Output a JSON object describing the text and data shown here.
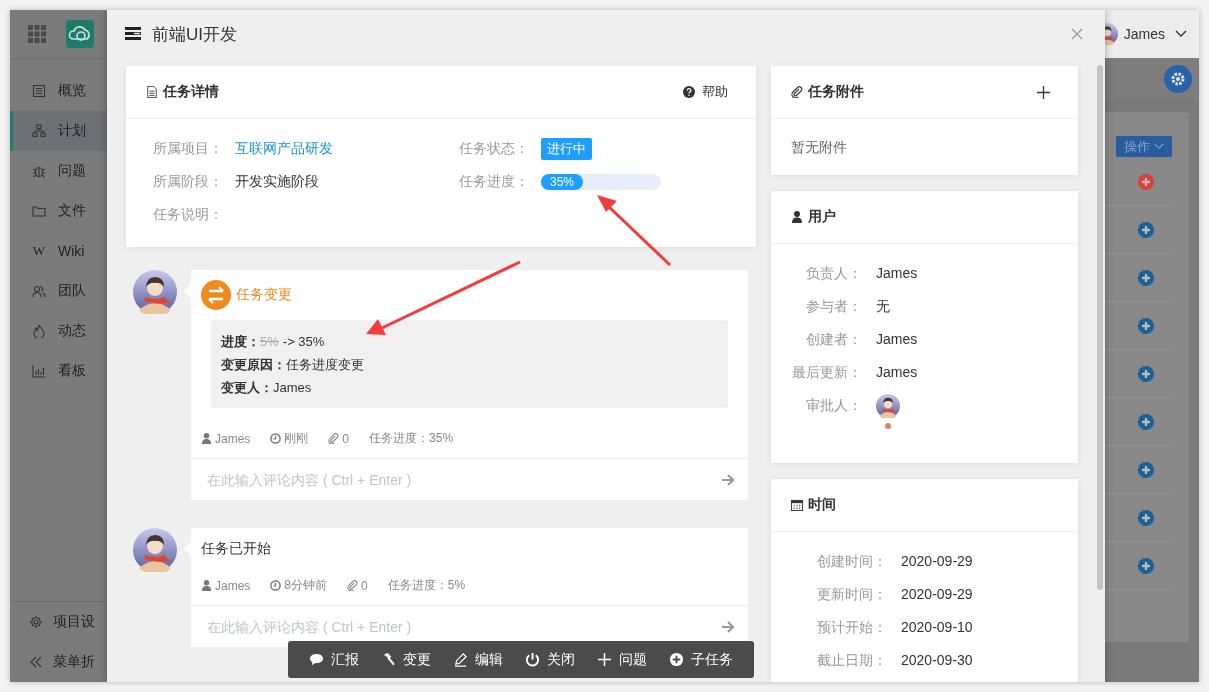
{
  "app": {
    "sidebar": {
      "items": [
        {
          "label": "概览",
          "selected": false
        },
        {
          "label": "计划",
          "selected": true
        },
        {
          "label": "问题",
          "selected": false
        },
        {
          "label": "文件",
          "selected": false
        },
        {
          "label": "Wiki",
          "glyph": "W",
          "selected": false
        },
        {
          "label": "团队",
          "selected": false
        },
        {
          "label": "动态",
          "selected": false
        },
        {
          "label": "看板",
          "selected": false
        }
      ],
      "footer": [
        {
          "label": "项目设"
        },
        {
          "label": "菜单折"
        }
      ]
    },
    "user": {
      "name": "James"
    },
    "panel": {
      "action_button": "操作",
      "rows": [
        {
          "color": "#d9403a"
        },
        {
          "color": "#1a5f96"
        },
        {
          "color": "#1a5f96"
        },
        {
          "color": "#1a5f96"
        },
        {
          "color": "#1a5f96"
        },
        {
          "color": "#1a5f96"
        },
        {
          "color": "#1a5f96"
        },
        {
          "color": "#1a5f96"
        },
        {
          "color": "#1a5f96"
        }
      ]
    }
  },
  "dialog": {
    "title": "前端UI开发",
    "details": {
      "title": "任务详情",
      "help": "帮助",
      "fields": [
        {
          "label": "所属项目：",
          "value": "互联网产品研发",
          "kind": "link"
        },
        {
          "label": "任务状态：",
          "value": "进行中",
          "kind": "badge"
        },
        {
          "label": "所属阶段：",
          "value": "开发实施阶段",
          "kind": "text"
        },
        {
          "label": "任务进度：",
          "value": "35%",
          "kind": "progress",
          "level": 0.35
        },
        {
          "label": "任务说明：",
          "kind": "text"
        }
      ]
    },
    "timeline": [
      {
        "kind": "change",
        "title": "任务变更",
        "lines": [
          {
            "label": "进度：",
            "old": "5%",
            "value": "-> 35%"
          },
          {
            "label": "变更原因：",
            "value": "任务进度变更"
          },
          {
            "label": "变更人：",
            "value": "James"
          }
        ],
        "author": "James",
        "time": "刚刚",
        "attachments": "0",
        "progress": "任务进度：35%",
        "comment_placeholder": "在此输入评论内容 ( Ctrl + Enter )"
      },
      {
        "kind": "text",
        "text": "任务已开始",
        "author": "James",
        "time": "8分钟前",
        "attachments": "0",
        "progress": "任务进度：5%",
        "comment_placeholder": "在此输入评论内容 ( Ctrl + Enter )"
      }
    ],
    "attachments": {
      "title": "任务附件",
      "empty": "暂无附件"
    },
    "users": {
      "title": "用户",
      "rows": [
        {
          "label": "负责人：",
          "value": "James",
          "kind": "text"
        },
        {
          "label": "参与者：",
          "value": "无",
          "kind": "text"
        },
        {
          "label": "创建者：",
          "value": "James",
          "kind": "text"
        },
        {
          "label": "最后更新：",
          "value": "James",
          "kind": "text"
        },
        {
          "label": "审批人：",
          "kind": "avatar",
          "color": "#e0835a"
        }
      ]
    },
    "time": {
      "title": "时间",
      "rows": [
        {
          "label": "创建时间：",
          "value": "2020-09-29"
        },
        {
          "label": "更新时间：",
          "value": "2020-09-29"
        },
        {
          "label": "预计开始：",
          "value": "2020-09-10"
        },
        {
          "label": "截止日期：",
          "value": "2020-09-30"
        }
      ]
    },
    "toolbar": [
      {
        "label": "汇报"
      },
      {
        "label": "变更"
      },
      {
        "label": "编辑"
      },
      {
        "label": "关闭"
      },
      {
        "label": "问题"
      },
      {
        "label": "子任务"
      }
    ]
  }
}
